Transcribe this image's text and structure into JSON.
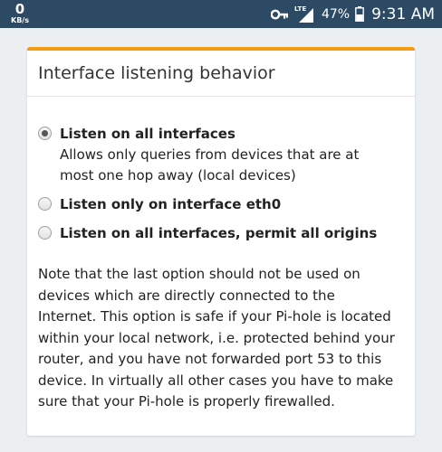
{
  "status_bar": {
    "net_speed_value": "0",
    "net_speed_unit": "KB/s",
    "network_type": "LTE",
    "battery_percent": "47%",
    "time": "9:31 AM",
    "background_color": "#2c4a63"
  },
  "card": {
    "accent_color": "#f39c12",
    "title": "Interface listening behavior",
    "options": [
      {
        "label": "Listen on all interfaces",
        "description": "Allows only queries from devices that are at most one hop away (local devices)",
        "checked": true
      },
      {
        "label": "Listen only on interface eth0",
        "description": "",
        "checked": false
      },
      {
        "label": "Listen on all interfaces, permit all origins",
        "description": "",
        "checked": false
      }
    ],
    "note": "Note that the last option should not be used on devices which are directly connected to the Internet. This option is safe if your Pi-hole is located within your local network, i.e. protected behind your router, and you have not forwarded port 53 to this device. In virtually all other cases you have to make sure that your Pi-hole is properly firewalled."
  }
}
